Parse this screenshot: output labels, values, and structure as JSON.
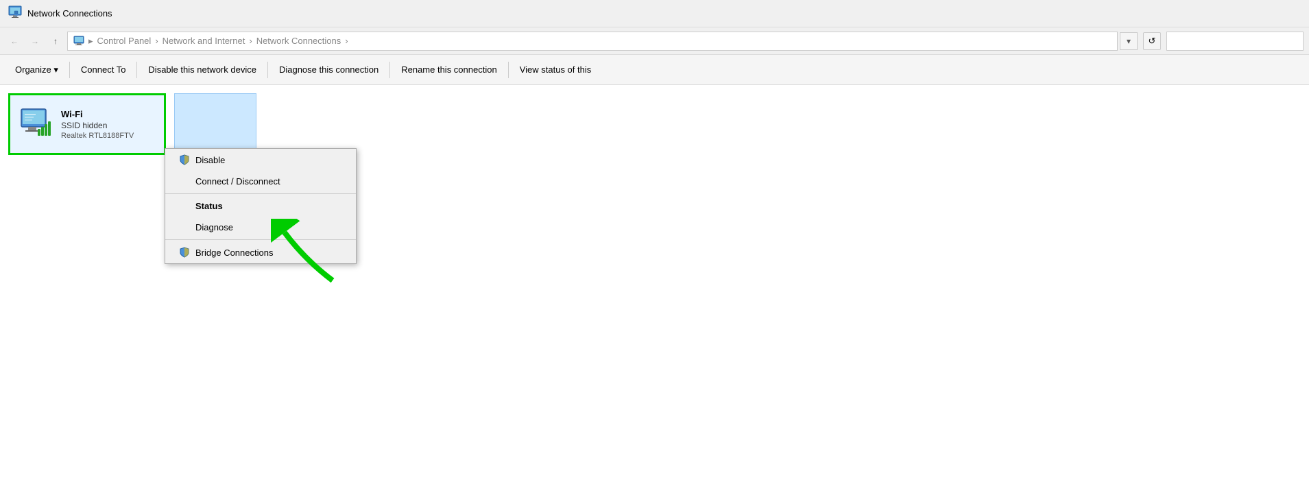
{
  "titleBar": {
    "icon": "network-connections-icon",
    "title": "Network Connections"
  },
  "addressBar": {
    "back_label": "←",
    "forward_label": "→",
    "up_label": "↑",
    "path": {
      "root": "Control Panel",
      "level1": "Network and Internet",
      "level2": "Network Connections"
    },
    "refresh_label": "↺",
    "dropdown_label": "▾"
  },
  "toolbar": {
    "organize_label": "Organize ▾",
    "connect_to_label": "Connect To",
    "disable_label": "Disable this network device",
    "diagnose_label": "Diagnose this connection",
    "rename_label": "Rename this connection",
    "view_status_label": "View status of this"
  },
  "networkItem": {
    "name": "Wi-Fi",
    "ssid": "SSID hidden",
    "adapter": "Realtek RTL8188FTV"
  },
  "contextMenu": {
    "items": [
      {
        "id": "disable",
        "label": "Disable",
        "hasShield": true,
        "bold": false
      },
      {
        "id": "connect-disconnect",
        "label": "Connect / Disconnect",
        "hasShield": false,
        "bold": false
      },
      {
        "id": "status",
        "label": "Status",
        "hasShield": false,
        "bold": true
      },
      {
        "id": "diagnose",
        "label": "Diagnose",
        "hasShield": false,
        "bold": false
      },
      {
        "id": "bridge",
        "label": "Bridge Connections",
        "hasShield": true,
        "bold": false
      }
    ]
  }
}
